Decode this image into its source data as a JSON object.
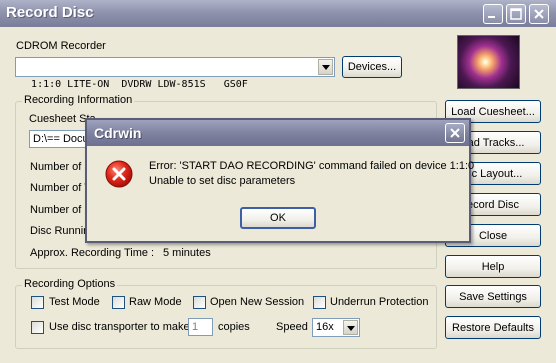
{
  "window": {
    "title": "Record Disc",
    "controls": [
      "minimize-icon",
      "maximize-icon",
      "close-icon"
    ]
  },
  "recorder": {
    "label": "CDROM Recorder",
    "selected": "1:1:0 LITE-ON  DVDRW LDW-851S   GS0F",
    "devices_button": "Devices..."
  },
  "recording_info": {
    "group_title": "Recording Information",
    "cuesheet_label": "Cuesheet Sta",
    "cuesheet_path": "D:\\== Docu",
    "rows": [
      "Number of F",
      "Number of T",
      "Number of C",
      "Disc Runnin"
    ],
    "approx_time_label": "Approx. Recording Time :",
    "approx_time_value": "5 minutes"
  },
  "side_buttons": {
    "load_cuesheet": "Load Cuesheet...",
    "load_tracks": "oad Tracks...",
    "disc_layout": "isc Layout...",
    "record_disc": "ecord Disc",
    "close": "Close",
    "help": "Help",
    "save_settings": "Save Settings",
    "restore_defaults": "Restore Defaults"
  },
  "recording_options": {
    "group_title": "Recording Options",
    "test_mode": "Test Mode",
    "raw_mode": "Raw Mode",
    "open_new_session": "Open New Session",
    "underrun_protection": "Underrun Protection",
    "disc_transporter_label": "Use disc transporter to make",
    "copies_value": "1",
    "copies_label": "copies",
    "speed_label": "Speed",
    "speed_value": "16x"
  },
  "dialog": {
    "title": "Cdrwin",
    "message_line1": "Error: 'START DAO RECORDING' command failed on device 1:1:0",
    "message_line2": "Unable to set disc parameters",
    "ok_button": "OK",
    "icon": "error-icon"
  },
  "colors": {
    "face": "#ece9d8",
    "titlebar": "#8f93ad",
    "error_red": "#d42020",
    "button_border": "#003c74"
  }
}
